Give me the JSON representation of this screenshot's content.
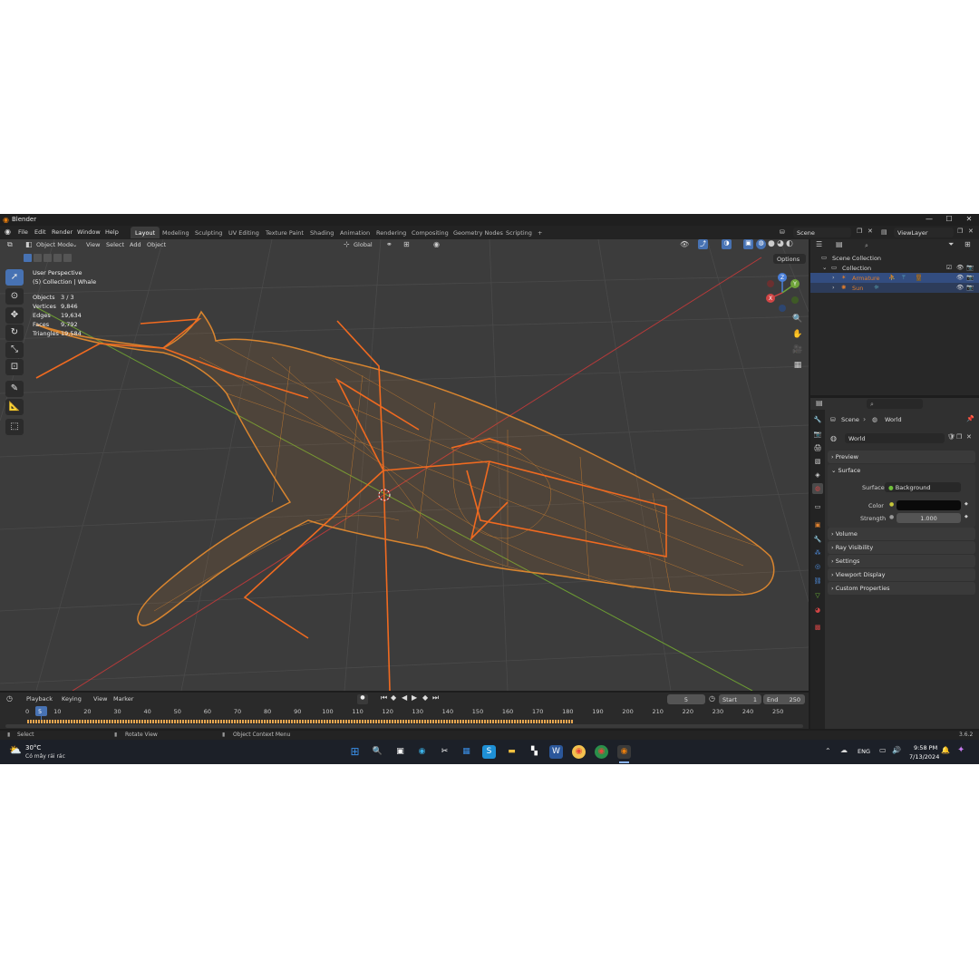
{
  "app": {
    "title": "Blender",
    "version": "3.6.2"
  },
  "window_controls": {
    "minimize": "—",
    "maximize": "☐",
    "close": "✕"
  },
  "menu": [
    "File",
    "Edit",
    "Render",
    "Window",
    "Help"
  ],
  "workspaces": [
    "Layout",
    "Modeling",
    "Sculpting",
    "UV Editing",
    "Texture Paint",
    "Shading",
    "Animation",
    "Rendering",
    "Compositing",
    "Geometry Nodes",
    "Scripting",
    "+"
  ],
  "scene_selector": {
    "value": "Scene"
  },
  "view_layer_selector": {
    "value": "ViewLayer"
  },
  "viewport_header": {
    "mode": "Object Mode",
    "menus": [
      "View",
      "Select",
      "Add",
      "Object"
    ],
    "orientation": "Global",
    "options_label": "Options"
  },
  "overlay": {
    "perspective": "User Perspective",
    "collection_info": "(5) Collection | Whale",
    "stats": [
      {
        "label": "Objects",
        "value": "3 / 3"
      },
      {
        "label": "Vertices",
        "value": "9,846"
      },
      {
        "label": "Edges",
        "value": "19,634"
      },
      {
        "label": "Faces",
        "value": "9,792"
      },
      {
        "label": "Triangles",
        "value": "19,584"
      }
    ]
  },
  "gizmo": {
    "z": "Z",
    "y": "Y",
    "x": "X"
  },
  "outliner": {
    "scene_collection": "Scene Collection",
    "collection": "Collection",
    "items": [
      {
        "label": "Armature",
        "color": "#e07d2c"
      },
      {
        "label": "Sun",
        "color": "#e07d2c"
      }
    ]
  },
  "properties": {
    "breadcrumb": [
      "Scene",
      "World"
    ],
    "world_name": "World",
    "panels_top": [
      "Preview",
      "Surface"
    ],
    "surface": {
      "surface_label": "Surface",
      "surface_value": "Background",
      "color_label": "Color",
      "strength_label": "Strength",
      "strength_value": "1.000"
    },
    "panels_bottom": [
      "Volume",
      "Ray Visibility",
      "Settings",
      "Viewport Display",
      "Custom Properties"
    ]
  },
  "timeline": {
    "menus": [
      "Playback",
      "Keying",
      "View",
      "Marker"
    ],
    "current_frame": "5",
    "start_label": "Start",
    "start_value": "1",
    "end_label": "End",
    "end_value": "250",
    "ticks": [
      "0",
      "5",
      "10",
      "20",
      "30",
      "40",
      "50",
      "60",
      "70",
      "80",
      "90",
      "100",
      "110",
      "120",
      "130",
      "140",
      "150",
      "160",
      "170",
      "180",
      "190",
      "200",
      "210",
      "220",
      "230",
      "240",
      "250"
    ]
  },
  "statusbar": {
    "select": "Select",
    "rotate": "Rotate View",
    "context": "Object Context Menu"
  },
  "taskbar": {
    "weather_temp": "30°C",
    "weather_desc": "Có mây rải rác",
    "language": "ENG",
    "time": "9:58 PM",
    "date": "7/13/2024"
  },
  "colors": {
    "accent_blue": "#4772b3",
    "selection_orange": "#e07d2c",
    "wire_orange": "#d9852f",
    "bone_orange": "#f06a20",
    "axis_red": "#b83a3a",
    "axis_green": "#6b9a33"
  }
}
